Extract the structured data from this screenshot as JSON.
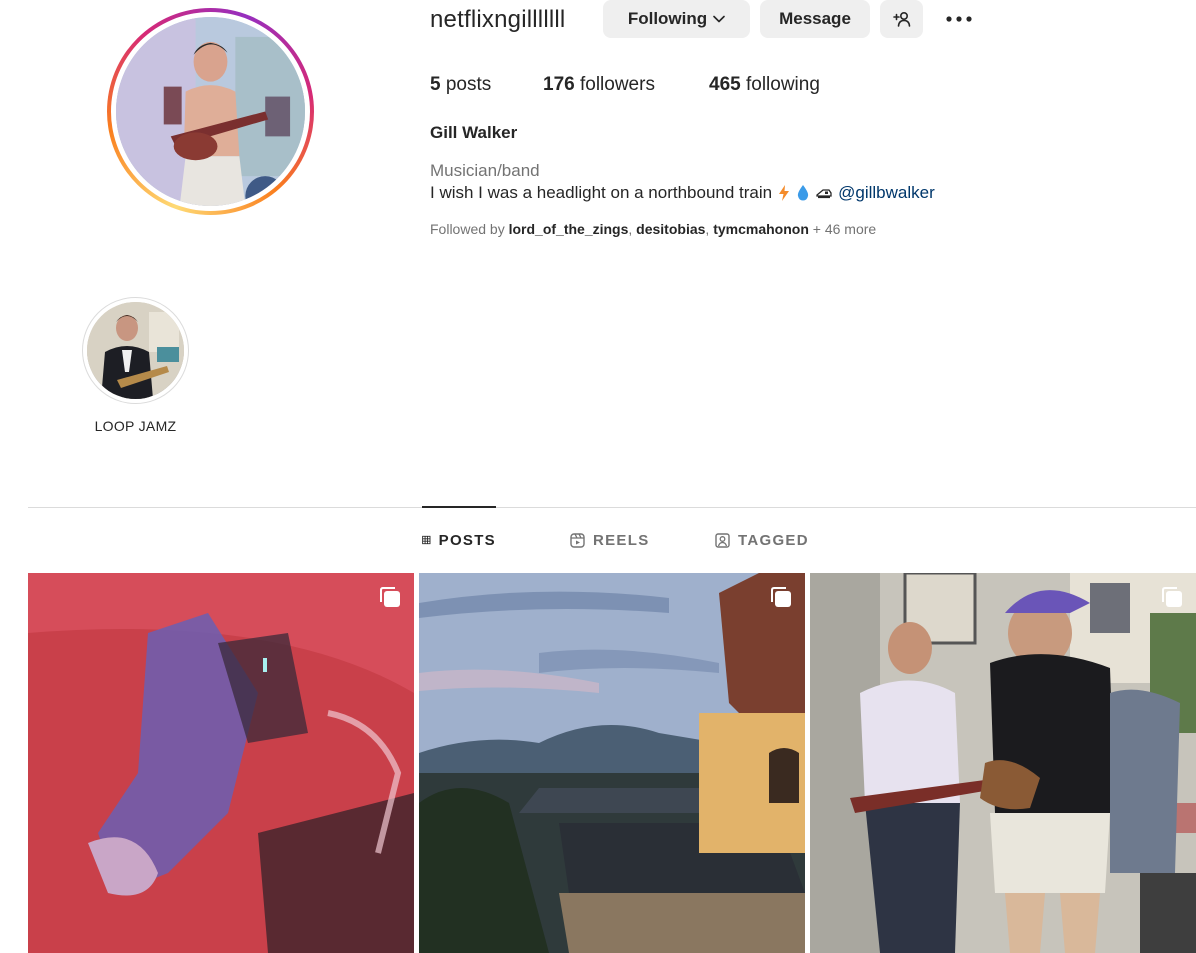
{
  "profile": {
    "username": "netflixngilllllll",
    "full_name": "Gill Walker",
    "category": "Musician/band",
    "bio_text": "I wish I was a headlight on a northbound train",
    "bio_link": "@gillbwalker"
  },
  "buttons": {
    "following": "Following",
    "message": "Message"
  },
  "stats": {
    "posts_count": "5",
    "posts_label": " posts",
    "followers_count": "176",
    "followers_label": " followers",
    "following_count": "465",
    "following_label": " following"
  },
  "followed_by": {
    "prefix": "Followed by ",
    "accounts": [
      "lord_of_the_zings",
      "desitobias",
      "tymcmahonon"
    ],
    "separator": ", ",
    "more": " + 46 more"
  },
  "highlights": [
    {
      "label": "LOOP JAMZ"
    }
  ],
  "tabs": [
    {
      "label": "POSTS",
      "icon": "grid-icon",
      "active": true
    },
    {
      "label": "REELS",
      "icon": "reels-icon",
      "active": false
    },
    {
      "label": "TAGGED",
      "icon": "tagged-icon",
      "active": false
    }
  ],
  "posts": [
    {
      "description_icon": "carousel-icon"
    },
    {
      "description_icon": "carousel-icon"
    },
    {
      "description_icon": "carousel-icon"
    }
  ],
  "colors": {
    "text_primary": "#262626",
    "text_secondary": "#737373",
    "link": "#00376b",
    "button_bg": "#efefef",
    "divider": "#dbdbdb"
  }
}
